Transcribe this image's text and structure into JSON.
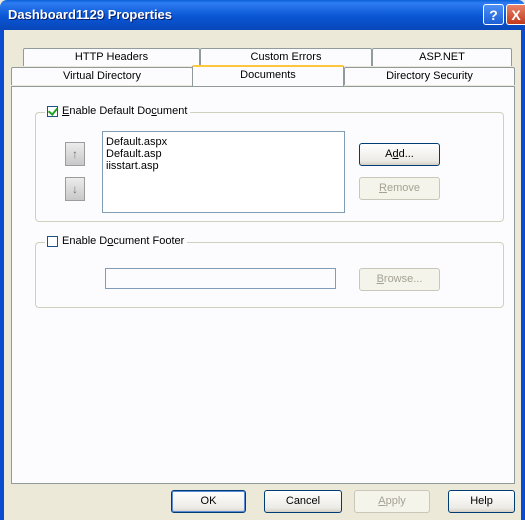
{
  "window": {
    "title": "Dashboard1129 Properties",
    "help_btn": "?",
    "close_btn": "X"
  },
  "tabs_row1": [
    {
      "label": "HTTP Headers"
    },
    {
      "label": "Custom Errors"
    },
    {
      "label": "ASP.NET"
    }
  ],
  "tabs_row2": [
    {
      "label": "Virtual Directory"
    },
    {
      "label": "Documents",
      "selected": true
    },
    {
      "label": "Directory Security"
    }
  ],
  "default_doc": {
    "checkbox_label": "Enable Default Document",
    "checked": true,
    "documents": [
      "Default.aspx",
      "Default.asp",
      "iisstart.asp"
    ],
    "move_up_icon": "arrow-up-icon",
    "move_down_icon": "arrow-down-icon",
    "add_label": "Add...",
    "remove_label": "Remove"
  },
  "footer_doc": {
    "checkbox_label": "Enable Document Footer",
    "checked": false,
    "path_value": "",
    "browse_label": "Browse..."
  },
  "buttons": {
    "ok": "OK",
    "cancel": "Cancel",
    "apply": "Apply",
    "help": "Help"
  }
}
